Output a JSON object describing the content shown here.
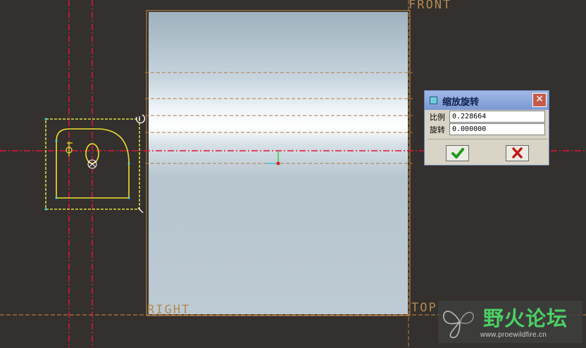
{
  "viewport": {
    "datums": {
      "front": "FRONT",
      "right": "RIGHT",
      "top": "TOP"
    }
  },
  "dialog": {
    "title": "缩放旋转",
    "close_label": "✕",
    "scale_label": "比例",
    "scale_value": "0.228664",
    "rotate_label": "旋转",
    "rotate_value": "0.000000",
    "ok_icon": "check-icon",
    "cancel_icon": "cross-icon"
  },
  "watermark": {
    "text": "野火论坛",
    "url": "www.proewildfire.cn"
  },
  "colors": {
    "background": "#33302d",
    "datum_plane": "#b08a52",
    "centerline": "#e0143c",
    "sketch": "#f0e030",
    "selection": "#ffff40",
    "ok_green": "#1f9a1f",
    "cancel_red": "#c01818",
    "dialog_title": "#8fa8dc"
  }
}
